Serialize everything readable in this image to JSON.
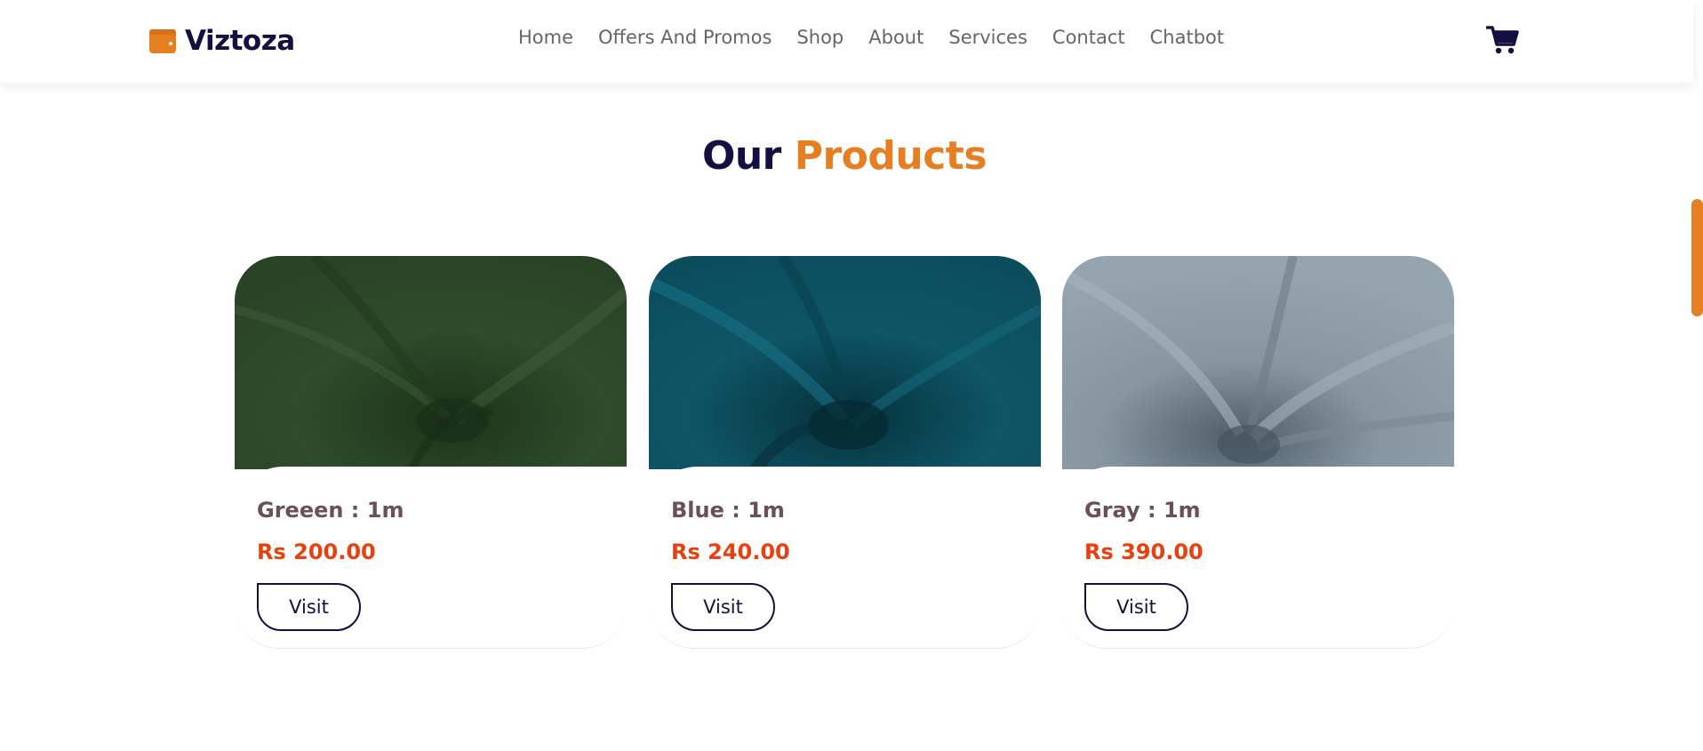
{
  "brand": {
    "name": "Viztoza",
    "icon": "wallet-icon",
    "color": "#e67e22"
  },
  "nav": {
    "links": [
      "Home",
      "Offers And Promos",
      "Shop",
      "About",
      "Services",
      "Contact",
      "Chatbot"
    ],
    "cart_icon": "shopping-cart-icon"
  },
  "section": {
    "title_dark": "Our",
    "title_accent": "Products"
  },
  "products": [
    {
      "title": "Greeen : 1m",
      "price": "Rs 200.00",
      "button": "Visit",
      "fabric_color": "#2e4a2a"
    },
    {
      "title": "Blue : 1m",
      "price": "Rs 240.00",
      "button": "Visit",
      "fabric_color": "#0f5566"
    },
    {
      "title": "Gray : 1m",
      "price": "Rs 390.00",
      "button": "Visit",
      "fabric_color": "#8a99a3"
    }
  ],
  "colors": {
    "primary_dark": "#130f40",
    "accent": "#e67e22",
    "price": "#e8410f"
  }
}
